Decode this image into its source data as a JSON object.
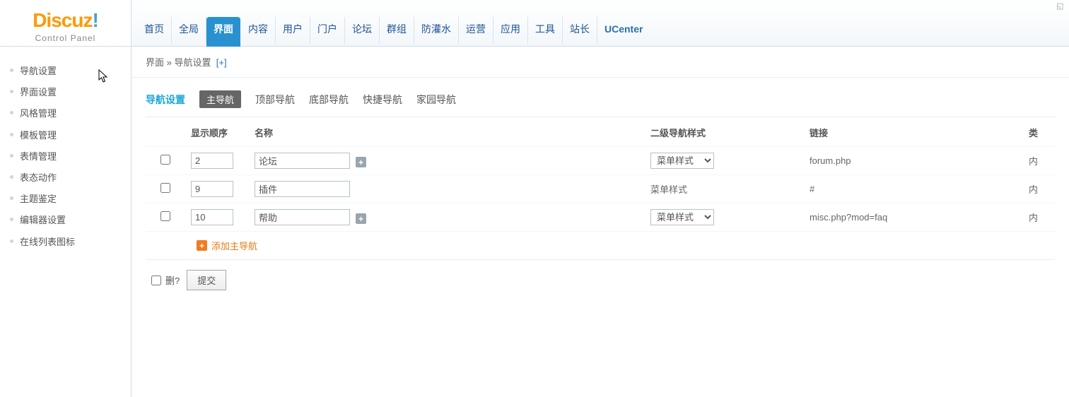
{
  "logo": {
    "main": "Discuz",
    "exclaim": "!",
    "sub": "Control Panel"
  },
  "nav": {
    "items": [
      "首页",
      "全局",
      "界面",
      "内容",
      "用户",
      "门户",
      "论坛",
      "群组",
      "防灌水",
      "运营",
      "应用",
      "工具",
      "站长",
      "UCenter"
    ],
    "activeIndex": 2
  },
  "sidebar": {
    "items": [
      "导航设置",
      "界面设置",
      "风格管理",
      "模板管理",
      "表情管理",
      "表态动作",
      "主题鉴定",
      "编辑器设置",
      "在线列表图标"
    ],
    "activeIndex": -1
  },
  "breadcrumb": {
    "a": "界面",
    "sep": " » ",
    "b": "导航设置",
    "plus": "[+]"
  },
  "subtabs": {
    "title": "导航设置",
    "items": [
      "主导航",
      "顶部导航",
      "底部导航",
      "快捷导航",
      "家园导航"
    ],
    "activeIndex": 0
  },
  "table": {
    "headers": {
      "order": "显示顺序",
      "name": "名称",
      "subnav": "二级导航样式",
      "link": "链接",
      "type": "类"
    },
    "rows": [
      {
        "order": "2",
        "name": "论坛",
        "hasPlus": true,
        "subnavSelect": true,
        "subnavText": "菜单样式",
        "link": "forum.php",
        "type": "内"
      },
      {
        "order": "9",
        "name": "插件",
        "hasPlus": false,
        "subnavSelect": false,
        "subnavText": "菜单样式",
        "link": "#",
        "type": "内"
      },
      {
        "order": "10",
        "name": "帮助",
        "hasPlus": true,
        "subnavSelect": true,
        "subnavText": "菜单样式",
        "link": "misc.php?mod=faq",
        "type": "内"
      }
    ],
    "addLabel": "添加主导航"
  },
  "submit": {
    "deleteLabel": "删?",
    "btn": "提交"
  }
}
